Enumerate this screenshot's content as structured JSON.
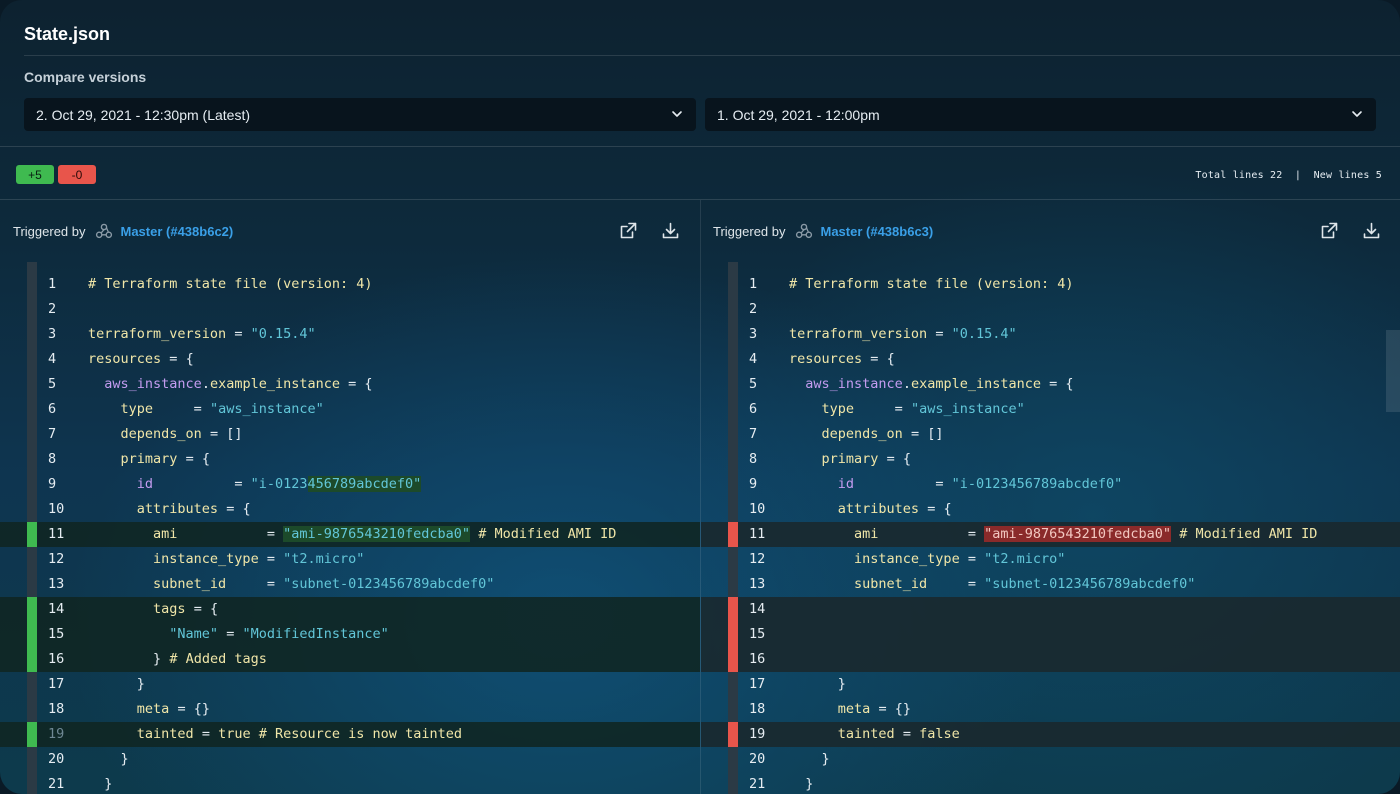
{
  "title": "State.json",
  "compare": {
    "label": "Compare versions",
    "left_version": "2. Oct 29, 2021 - 12:30pm (Latest)",
    "right_version": "1. Oct 29, 2021 - 12:00pm"
  },
  "diff_summary": {
    "added": "+5",
    "removed": "-0",
    "stats": "Total lines 22  |  New lines 5",
    "colors": {
      "added": "#3fba50",
      "removed": "#e8554b"
    }
  },
  "left_pane": {
    "triggered_by": "Triggered by",
    "source_icon": "webhook-icon",
    "branch": "Master (#438b6c2)"
  },
  "right_pane": {
    "triggered_by": "Triggered by",
    "source_icon": "webhook-icon",
    "branch": "Master (#438b6c3)"
  },
  "actions": {
    "open_icon": "external-link-icon",
    "download_icon": "download-icon"
  },
  "left_lines": [
    {
      "n": "1",
      "text": "# Terraform state file (version: 4)"
    },
    {
      "n": "2",
      "text": ""
    },
    {
      "n": "3",
      "text": "terraform_version = \"0.15.4\""
    },
    {
      "n": "4",
      "text": "resources = {"
    },
    {
      "n": "5",
      "text": "  aws_instance.example_instance = {"
    },
    {
      "n": "6",
      "text": "    type     = \"aws_instance\""
    },
    {
      "n": "7",
      "text": "    depends_on = []"
    },
    {
      "n": "8",
      "text": "    primary = {"
    },
    {
      "n": "9",
      "text": "      id          = \"i-0123456789abcdef0\""
    },
    {
      "n": "10",
      "text": "      attributes = {"
    },
    {
      "n": "11",
      "text": "        ami           = \"ami-9876543210fedcba0\" # Modified AMI ID",
      "state": "add"
    },
    {
      "n": "12",
      "text": "        instance_type = \"t2.micro\""
    },
    {
      "n": "13",
      "text": "        subnet_id     = \"subnet-0123456789abcdef0\""
    },
    {
      "n": "14",
      "text": "        tags = {",
      "state": "add"
    },
    {
      "n": "15",
      "text": "          \"Name\" = \"ModifiedInstance\"",
      "state": "add"
    },
    {
      "n": "16",
      "text": "        } # Added tags",
      "state": "add"
    },
    {
      "n": "17",
      "text": "      }"
    },
    {
      "n": "18",
      "text": "      meta = {}"
    },
    {
      "n": "19",
      "text": "      tainted = true # Resource is now tainted",
      "state": "add"
    },
    {
      "n": "20",
      "text": "    }"
    },
    {
      "n": "21",
      "text": "  }"
    }
  ],
  "right_lines": [
    {
      "n": "1",
      "text": "# Terraform state file (version: 4)"
    },
    {
      "n": "2",
      "text": ""
    },
    {
      "n": "3",
      "text": "terraform_version = \"0.15.4\""
    },
    {
      "n": "4",
      "text": "resources = {"
    },
    {
      "n": "5",
      "text": "  aws_instance.example_instance = {"
    },
    {
      "n": "6",
      "text": "    type     = \"aws_instance\""
    },
    {
      "n": "7",
      "text": "    depends_on = []"
    },
    {
      "n": "8",
      "text": "    primary = {"
    },
    {
      "n": "9",
      "text": "      id          = \"i-0123456789abcdef0\""
    },
    {
      "n": "10",
      "text": "      attributes = {"
    },
    {
      "n": "11",
      "text": "        ami           = \"ami-9876543210fedcba0\" # Modified AMI ID",
      "state": "del"
    },
    {
      "n": "12",
      "text": "        instance_type = \"t2.micro\""
    },
    {
      "n": "13",
      "text": "        subnet_id     = \"subnet-0123456789abcdef0\""
    },
    {
      "n": "14",
      "text": "",
      "state": "del"
    },
    {
      "n": "15",
      "text": "",
      "state": "del"
    },
    {
      "n": "16",
      "text": "",
      "state": "del"
    },
    {
      "n": "17",
      "text": "      }"
    },
    {
      "n": "18",
      "text": "      meta = {}"
    },
    {
      "n": "19",
      "text": "      tainted = false",
      "state": "del"
    },
    {
      "n": "20",
      "text": "    }"
    },
    {
      "n": "21",
      "text": "  }"
    }
  ]
}
